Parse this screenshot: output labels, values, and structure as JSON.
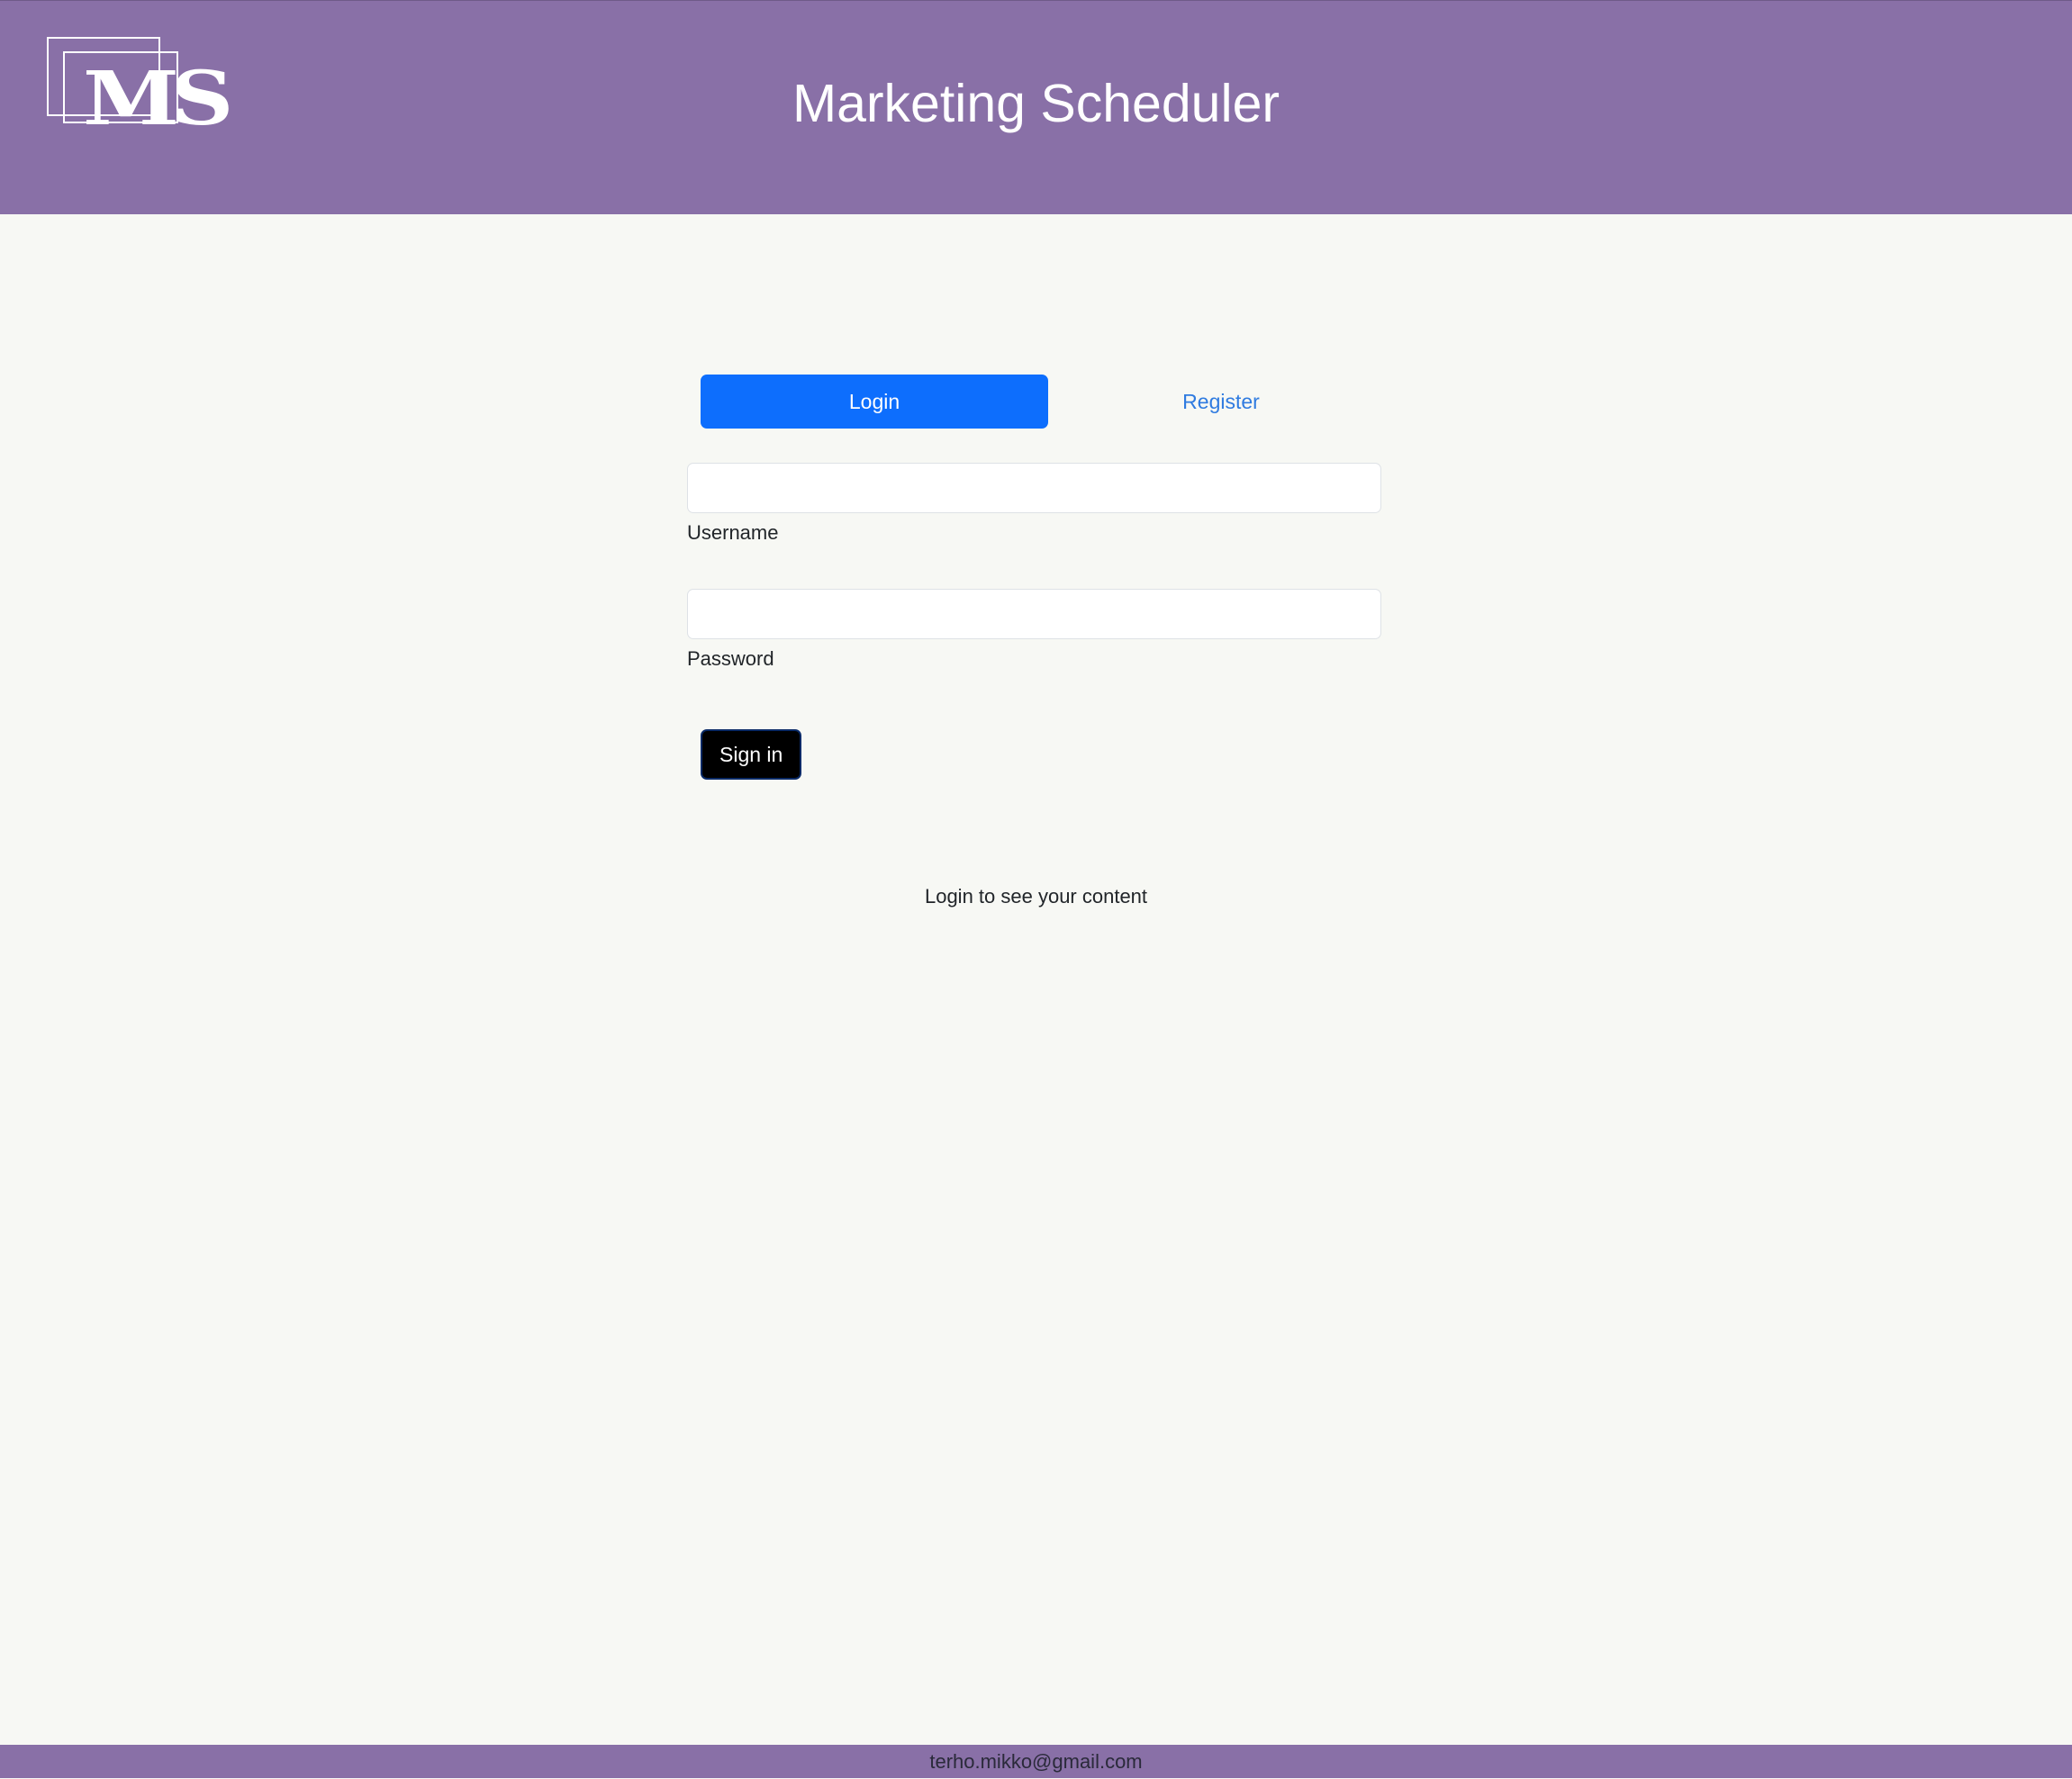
{
  "header": {
    "logo_text": "MS",
    "title": "Marketing Scheduler"
  },
  "tabs": {
    "login_label": "Login",
    "register_label": "Register",
    "active": "Login"
  },
  "form": {
    "username_label": "Username",
    "username_value": "",
    "password_label": "Password",
    "password_value": "",
    "submit_label": "Sign in"
  },
  "hint": "Login to see your content",
  "footer": {
    "email": "terho.mikko@gmail.com"
  },
  "colors": {
    "header_bg": "#8970a7",
    "page_bg": "#f7f8f4",
    "active_tab": "#0d6efd",
    "link": "#2f7be0",
    "button_bg": "#000000"
  }
}
